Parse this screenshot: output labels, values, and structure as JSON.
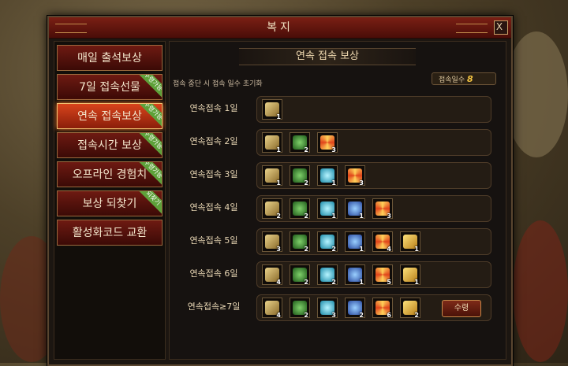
{
  "window": {
    "title": "복지",
    "close_label": "X"
  },
  "menu": [
    {
      "label": "매일 출석보상",
      "badge": ""
    },
    {
      "label": "7일 접속선물",
      "badge": "수령가능"
    },
    {
      "label": "연속 접속보상",
      "badge": "수령가능",
      "active": true
    },
    {
      "label": "접속시간 보상",
      "badge": "수령가능"
    },
    {
      "label": "오프라인 경험치",
      "badge": "수령가능"
    },
    {
      "label": "보상 되찾기",
      "badge": "되찾기"
    },
    {
      "label": "활성화코드 교환",
      "badge": ""
    }
  ],
  "panel": {
    "heading": "연속 접속 보상",
    "notice": "접속 중단 시 접속 일수 초기화",
    "days_label": "접속일수",
    "days_value": "8",
    "claim_label": "수령"
  },
  "rewards": [
    {
      "label": "연속접속 1일",
      "items": [
        {
          "icon": "chest-icon",
          "count": "1"
        }
      ]
    },
    {
      "label": "연속접속 2일",
      "items": [
        {
          "icon": "chest-icon",
          "count": "1"
        },
        {
          "icon": "green-pouch-icon",
          "count": "2"
        },
        {
          "icon": "star-gem-icon",
          "count": "3"
        }
      ]
    },
    {
      "label": "연속접속 3일",
      "items": [
        {
          "icon": "chest-icon",
          "count": "1"
        },
        {
          "icon": "green-pouch-icon",
          "count": "2"
        },
        {
          "icon": "blue-orb-icon",
          "count": "1"
        },
        {
          "icon": "star-gem-icon",
          "count": "3"
        }
      ]
    },
    {
      "label": "연속접속 4일",
      "items": [
        {
          "icon": "chest-icon",
          "count": "2"
        },
        {
          "icon": "green-pouch-icon",
          "count": "2"
        },
        {
          "icon": "blue-orb-icon",
          "count": "1"
        },
        {
          "icon": "blue-crystal-icon",
          "count": "1"
        },
        {
          "icon": "star-gem-icon",
          "count": "3"
        }
      ]
    },
    {
      "label": "연속접속 5일",
      "items": [
        {
          "icon": "chest-icon",
          "count": "3"
        },
        {
          "icon": "green-pouch-icon",
          "count": "2"
        },
        {
          "icon": "blue-orb-icon",
          "count": "2"
        },
        {
          "icon": "blue-crystal-icon",
          "count": "1"
        },
        {
          "icon": "star-gem-icon",
          "count": "4"
        },
        {
          "icon": "gold-box-icon",
          "count": "1"
        }
      ]
    },
    {
      "label": "연속접속 6일",
      "items": [
        {
          "icon": "chest-icon",
          "count": "4"
        },
        {
          "icon": "green-pouch-icon",
          "count": "2"
        },
        {
          "icon": "blue-orb-icon",
          "count": "2"
        },
        {
          "icon": "blue-crystal-icon",
          "count": "1"
        },
        {
          "icon": "star-gem-icon",
          "count": "5"
        },
        {
          "icon": "gold-box-icon",
          "count": "1"
        }
      ]
    },
    {
      "label": "연속접속≥7일",
      "items": [
        {
          "icon": "chest-icon",
          "count": "4"
        },
        {
          "icon": "green-pouch-icon",
          "count": "2"
        },
        {
          "icon": "blue-orb-icon",
          "count": "3"
        },
        {
          "icon": "blue-crystal-icon",
          "count": "2"
        },
        {
          "icon": "star-gem-icon",
          "count": "6"
        },
        {
          "icon": "gold-box-icon",
          "count": "2"
        }
      ],
      "claimable": true
    }
  ],
  "colors": {
    "accent_red": "#d8441c",
    "badge_green": "#5ea13a",
    "gold": "#f5c542"
  }
}
